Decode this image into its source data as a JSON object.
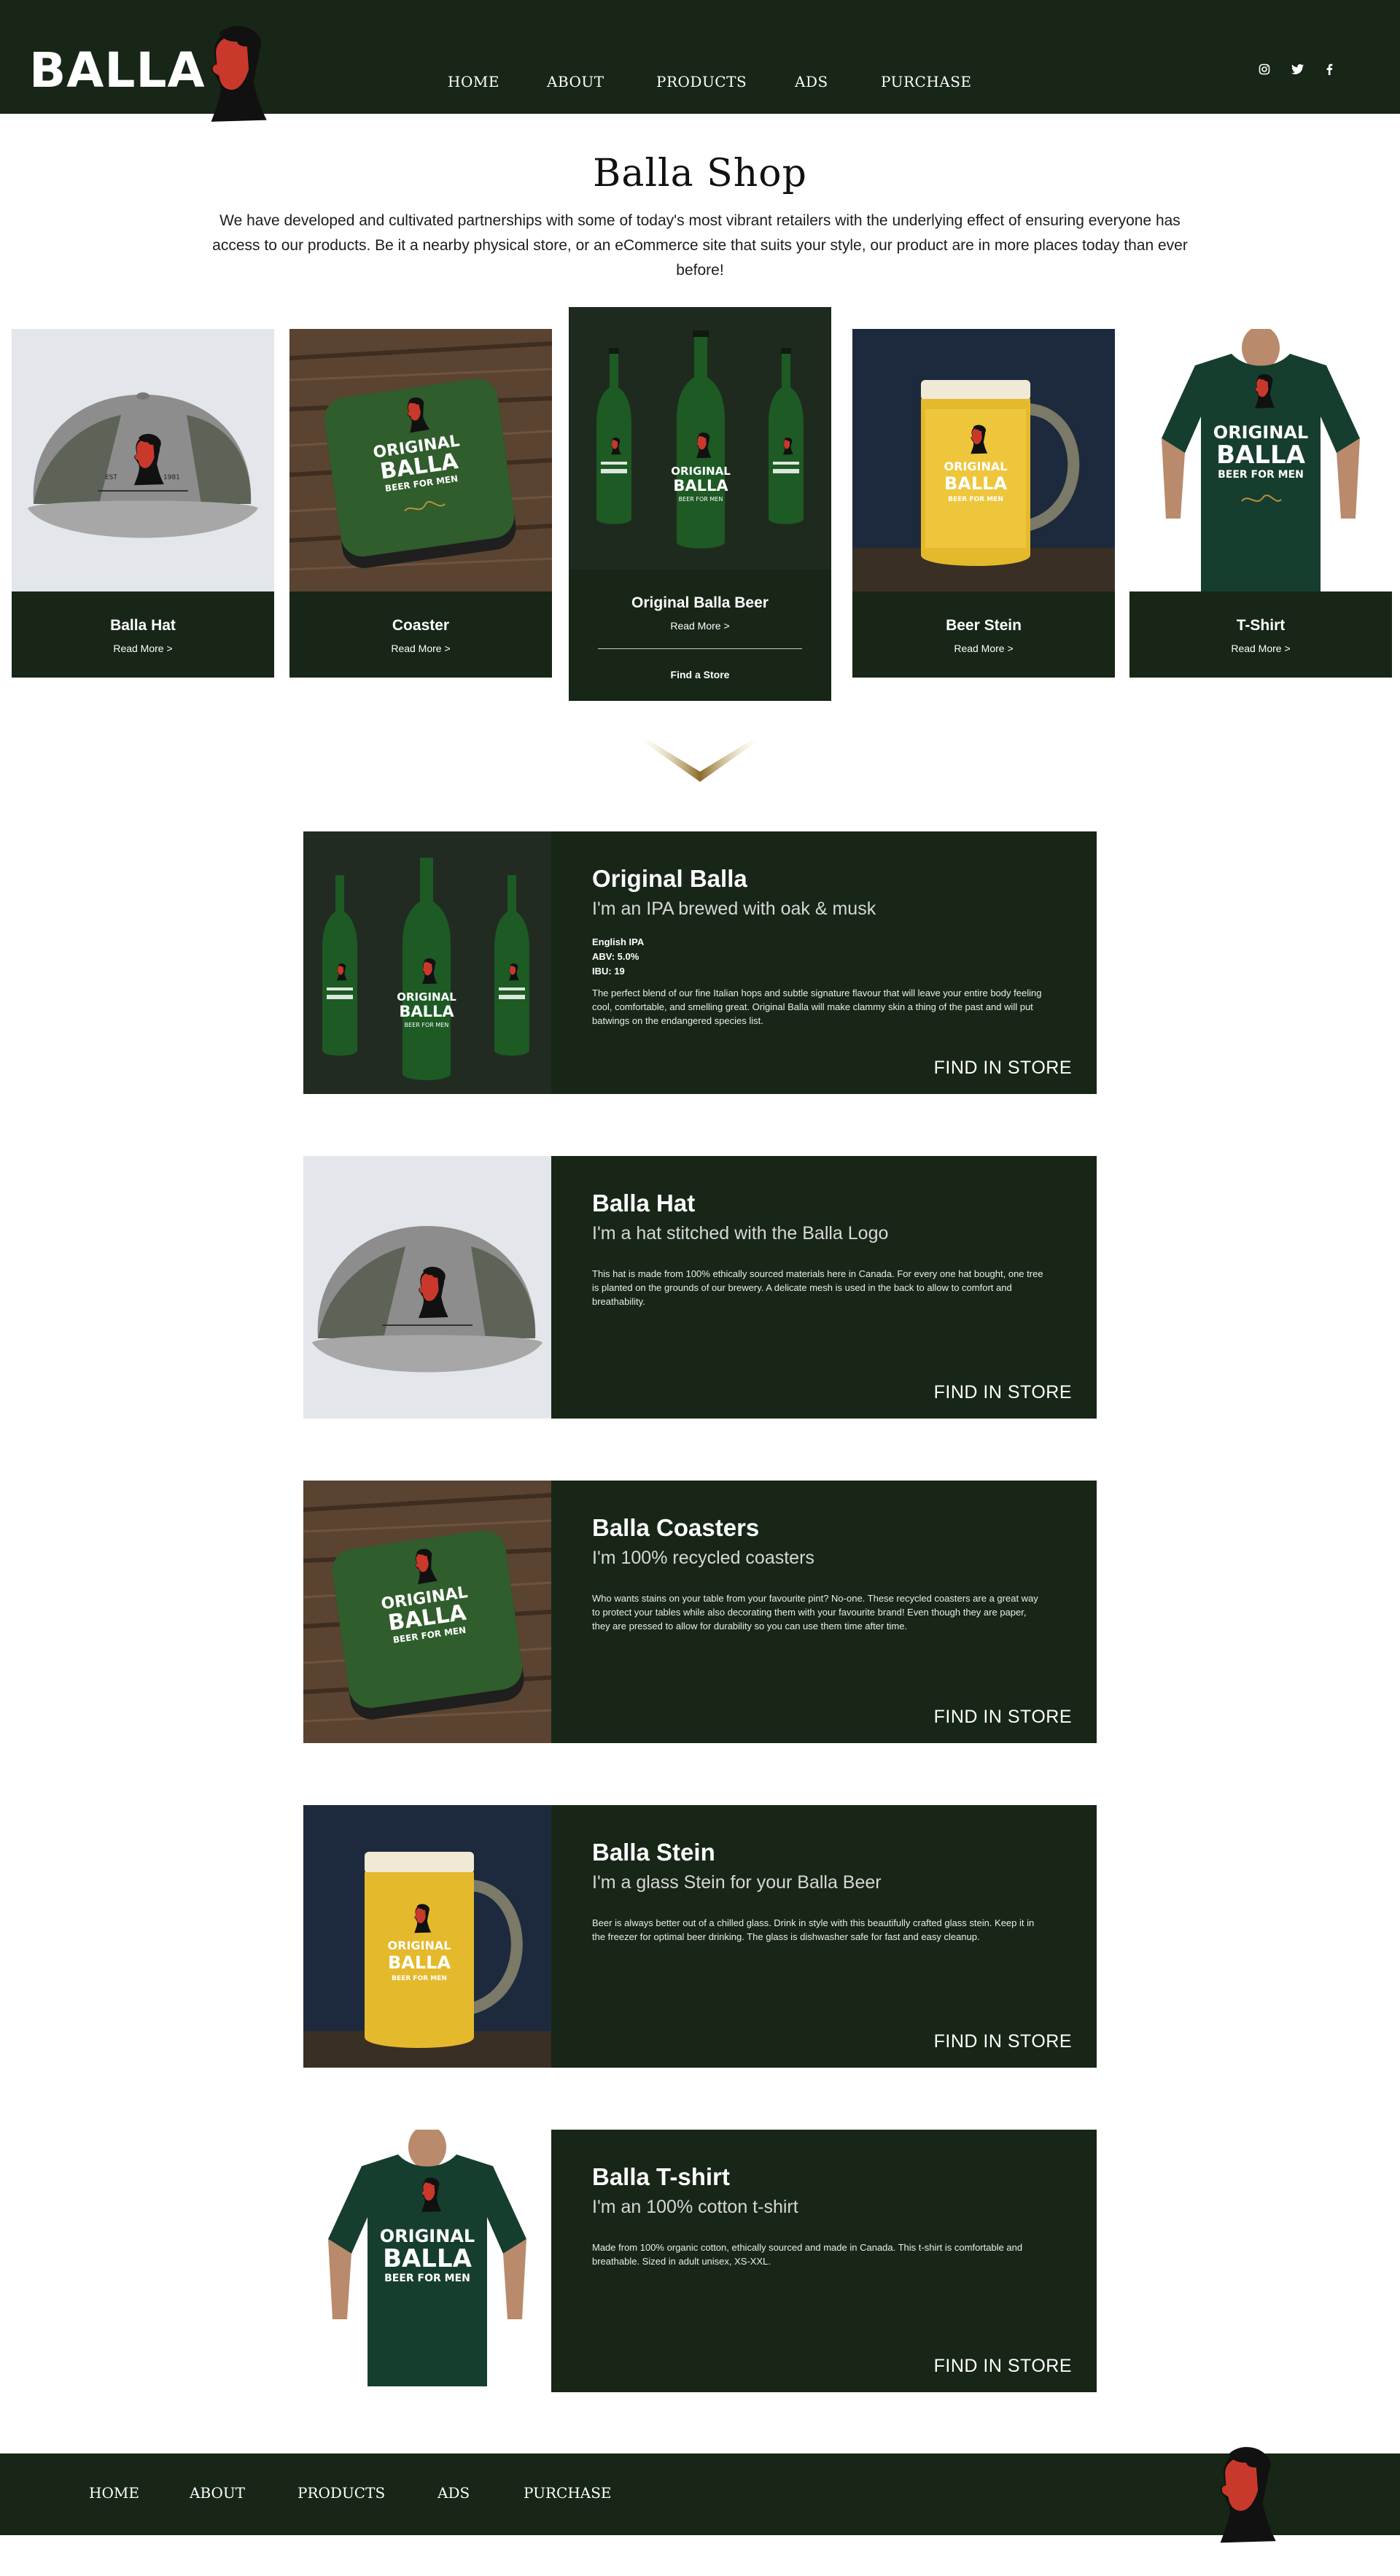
{
  "colors": {
    "brand_green": "#172616",
    "accent_red": "#c9392b",
    "cap_grey": "#9a9a9a",
    "gold": "#b8923e"
  },
  "header": {
    "brand": "BALLA",
    "nav": [
      "HOME",
      "ABOUT",
      "PRODUCTS",
      "ADS",
      "PURCHASE"
    ],
    "social_icons": [
      "instagram-icon",
      "twitter-icon",
      "facebook-icon"
    ]
  },
  "shop": {
    "title": "Balla Shop",
    "intro": "We have developed and cultivated partnerships with some of today's most vibrant retailers with the underlying effect of ensuring everyone has access to our products. Be it a nearby physical store, or an eCommerce site that suits your style, our product are in more places today than ever before!"
  },
  "cards": [
    {
      "name": "Balla Hat",
      "link": "Read More >"
    },
    {
      "name": "Coaster",
      "link": "Read More >"
    },
    {
      "name": "Original Balla Beer",
      "link": "Read More >",
      "store": "Find a Store"
    },
    {
      "name": "Beer Stein",
      "link": "Read More >"
    },
    {
      "name": "T-Shirt",
      "link": "Read More >"
    }
  ],
  "label_art": {
    "top": "ORIGINAL",
    "main": "BALLA",
    "bottom": "BEER FOR MEN",
    "est_left": "EST",
    "est_right": "1981"
  },
  "details": [
    {
      "title": "Original Balla",
      "subtitle": "I'm an IPA brewed with oak & musk",
      "specs": [
        "English IPA",
        "ABV: 5.0%",
        "IBU: 19"
      ],
      "desc": "The perfect blend of our fine Italian hops and subtle signature flavour that will leave your entire body feeling cool, comfortable, and smelling great. Original Balla will make clammy skin a thing of the past and will put batwings on the endangered species list.",
      "cta": "FIND IN STORE"
    },
    {
      "title": "Balla Hat",
      "subtitle": "I'm a hat stitched with the Balla Logo",
      "desc": "This hat is made from 100% ethically sourced materials here in Canada. For every one hat bought, one tree is planted on the grounds of our brewery. A delicate mesh is used in the back to allow to comfort and breathability.",
      "cta": "FIND IN STORE"
    },
    {
      "title": "Balla Coasters",
      "subtitle": "I'm 100% recycled coasters",
      "desc": "Who wants stains on your table from your favourite pint? No-one.  These recycled coasters are a great way to protect your tables while also decorating them with your favourite brand! Even though they are paper, they are pressed to allow for durability so you can use them time after time.",
      "cta": "FIND IN STORE"
    },
    {
      "title": "Balla Stein",
      "subtitle": "I'm a glass Stein for your Balla Beer",
      "desc": "Beer is always better out of a chilled glass. Drink in style with this beautifully crafted glass stein. Keep it in the freezer for optimal beer drinking. The glass is dishwasher safe for fast and easy cleanup.",
      "cta": "FIND IN STORE"
    },
    {
      "title": "Balla T-shirt",
      "subtitle": "I'm an 100% cotton t-shirt",
      "desc": "Made from 100% organic cotton, ethically sourced and made in Canada. This t-shirt is comfortable and breathable. Sized in adult unisex, XS-XXL.",
      "cta": "FIND IN STORE"
    }
  ],
  "footer": {
    "nav": [
      "HOME",
      "ABOUT",
      "PRODUCTS",
      "ADS",
      "PURCHASE"
    ]
  }
}
